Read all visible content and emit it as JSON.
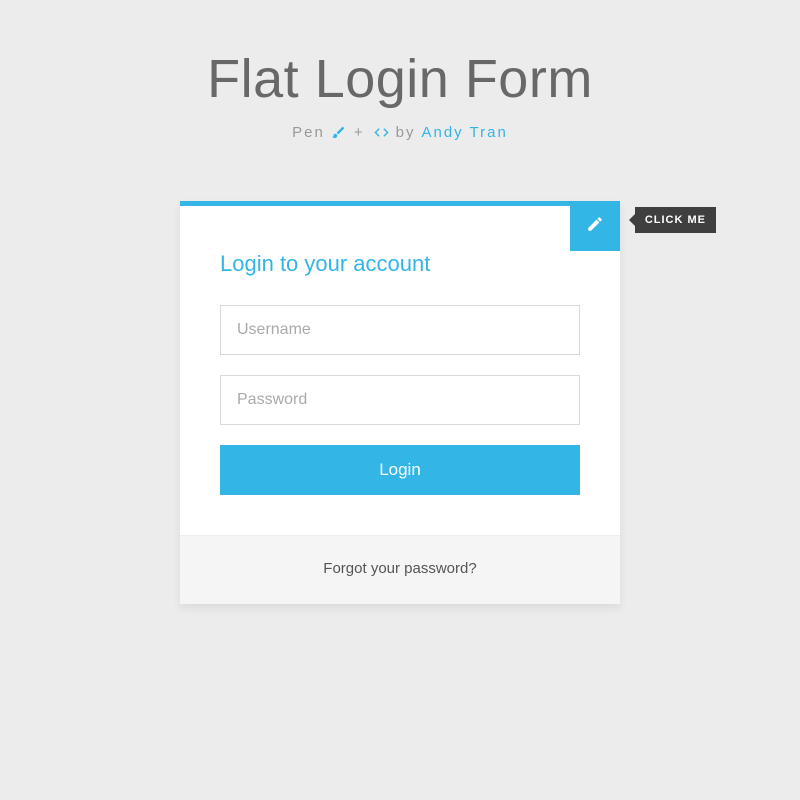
{
  "header": {
    "title": "Flat Login Form",
    "pen_label": "Pen",
    "plus": "+",
    "by": "by",
    "author": "Andy Tran"
  },
  "card": {
    "tooltip": "CLICK ME",
    "form_title": "Login to your account",
    "username_placeholder": "Username",
    "password_placeholder": "Password",
    "login_label": "Login",
    "forgot_label": "Forgot your password?"
  },
  "colors": {
    "accent": "#33b5e5",
    "bg": "#ececec",
    "tooltip_bg": "#3f3f3f"
  }
}
